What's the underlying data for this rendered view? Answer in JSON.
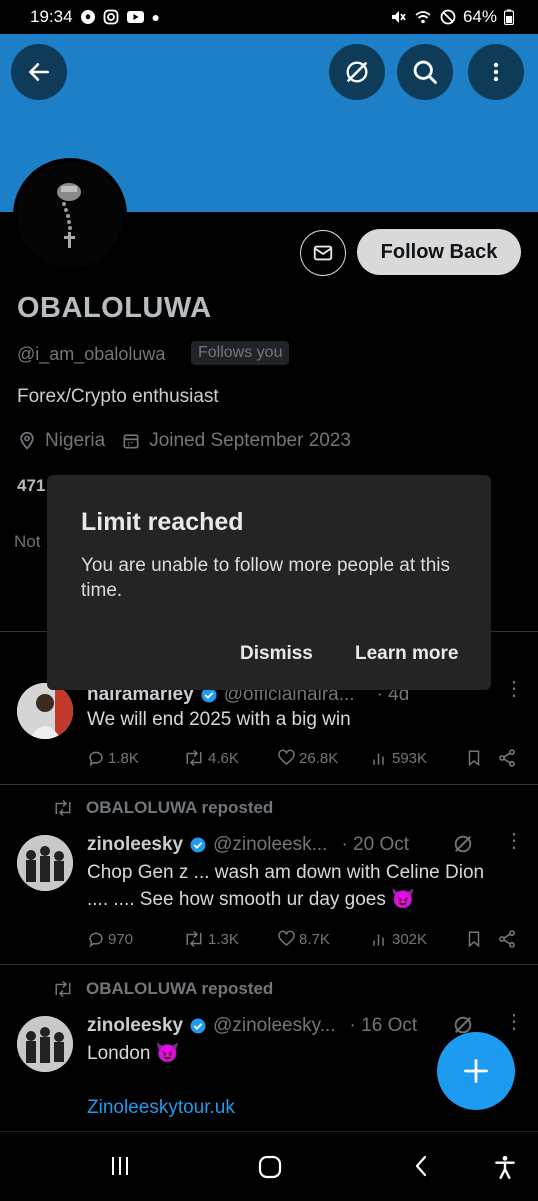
{
  "status": {
    "time": "19:34",
    "battery": "64%"
  },
  "profile": {
    "name": "OBALOLUWA",
    "handle": "@i_am_obaloluwa",
    "follows_you": "Follows you",
    "bio": "Forex/Crypto enthusiast",
    "location": "Nigeria",
    "joined": "Joined September 2023",
    "follow_back_label": "Follow Back",
    "partial_count": "471",
    "partial_text": "Not"
  },
  "dialog": {
    "title": "Limit reached",
    "body": "You are unable to follow more people at this time.",
    "dismiss": "Dismiss",
    "learn_more": "Learn more"
  },
  "posts": [
    {
      "author": "nairamarley",
      "handle": "@officialnaira...",
      "time": "· 4d",
      "text": "We will end 2025 with a big win",
      "replies": "1.8K",
      "reposts": "4.6K",
      "likes": "26.8K",
      "views": "593K"
    },
    {
      "repost_label": "OBALOLUWA reposted",
      "author": "zinoleesky",
      "handle": "@zinoleesk...",
      "time": "· 20 Oct",
      "text": "Chop Gen z ... wash am down with Celine Dion .... .... See how smooth ur day goes 😈",
      "replies": "970",
      "reposts": "1.3K",
      "likes": "8.7K",
      "views": "302K"
    },
    {
      "repost_label": "OBALOLUWA reposted",
      "author": "zinoleesky",
      "handle": "@zinoleesky...",
      "time": "· 16 Oct",
      "text": "London 😈",
      "link": "Zinoleeskytour.uk"
    }
  ],
  "colors": {
    "banner": "#1d7fc7",
    "accent": "#1d9bf0",
    "dialog": "#242424"
  }
}
